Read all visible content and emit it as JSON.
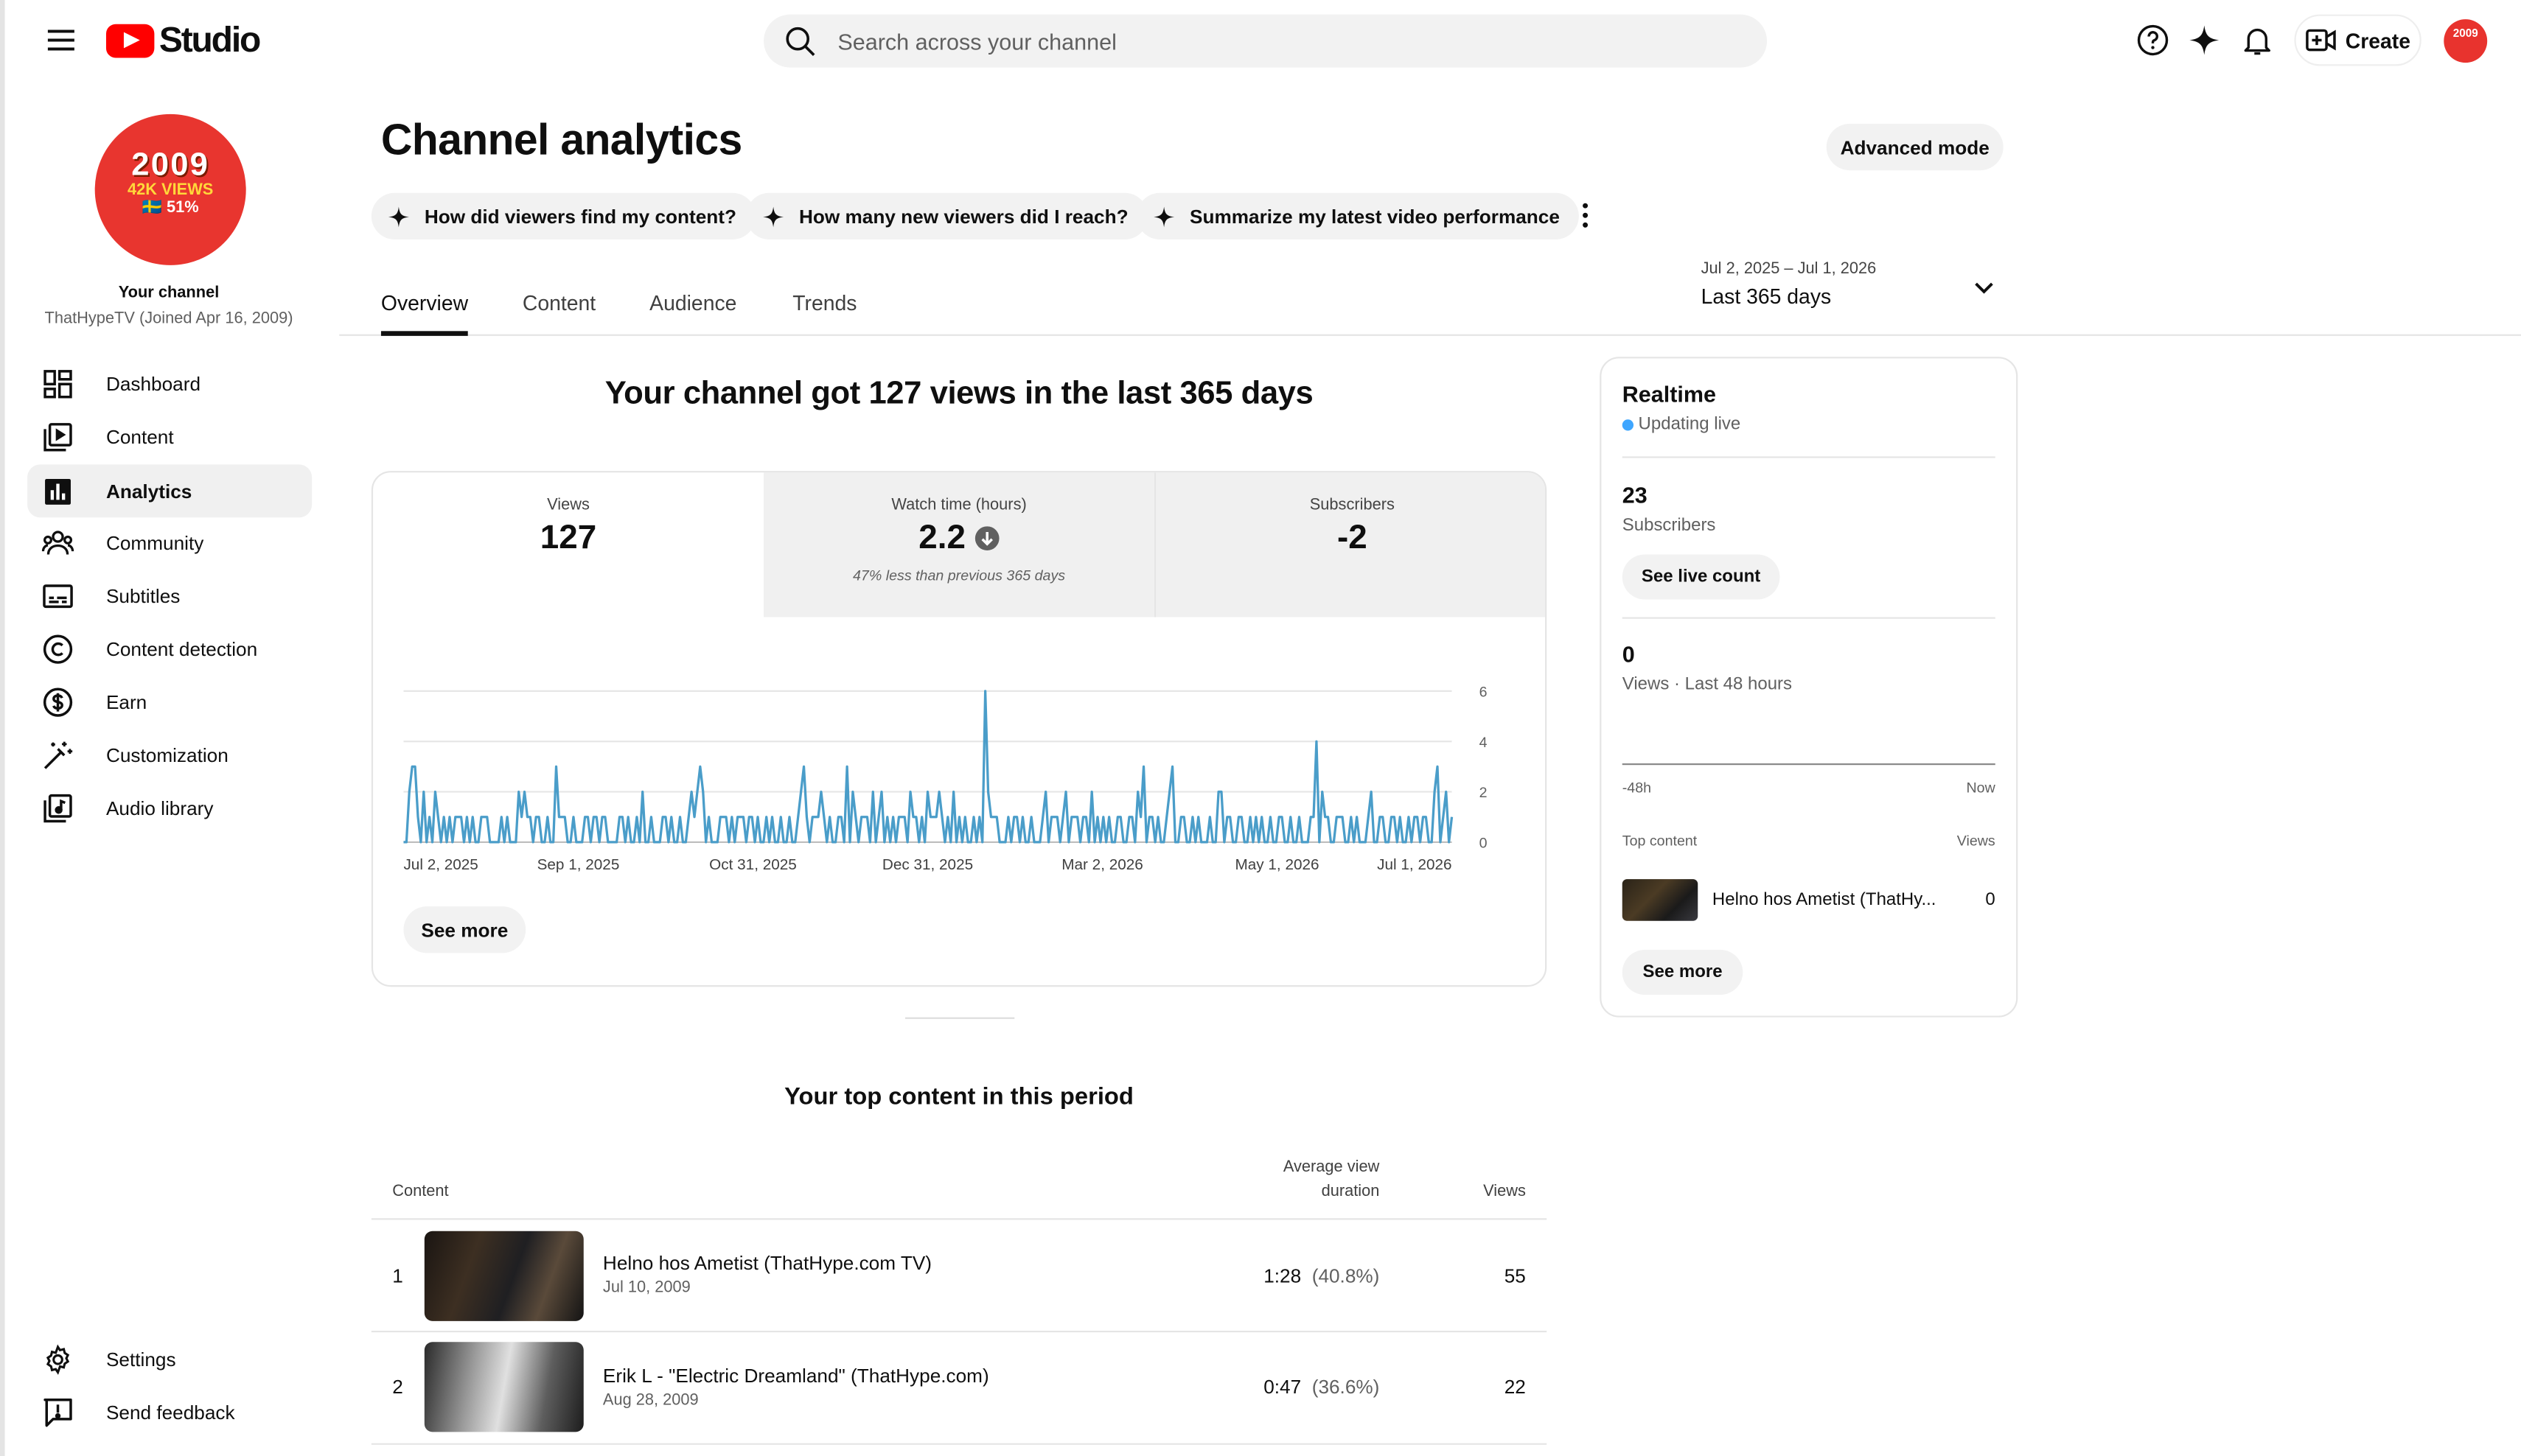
{
  "header": {
    "logo_text": "Studio",
    "search_placeholder": "Search across your channel",
    "create_label": "Create"
  },
  "channel": {
    "avatar_lines": [
      "2009",
      "42K VIEWS",
      "🇸🇪 51%"
    ],
    "your_channel_label": "Your channel",
    "subtitle": "ThatHypeTV (Joined Apr 16, 2009)"
  },
  "sidebar": {
    "items": [
      {
        "label": "Dashboard",
        "icon": "dashboard-icon"
      },
      {
        "label": "Content",
        "icon": "content-icon"
      },
      {
        "label": "Analytics",
        "icon": "analytics-icon",
        "active": true
      },
      {
        "label": "Community",
        "icon": "community-icon"
      },
      {
        "label": "Subtitles",
        "icon": "subtitles-icon"
      },
      {
        "label": "Content detection",
        "icon": "copyright-icon"
      },
      {
        "label": "Earn",
        "icon": "dollar-icon"
      },
      {
        "label": "Customization",
        "icon": "magic-wand-icon"
      },
      {
        "label": "Audio library",
        "icon": "audio-library-icon"
      }
    ],
    "settings_label": "Settings",
    "feedback_label": "Send feedback"
  },
  "main": {
    "title": "Channel analytics",
    "advanced_mode_label": "Advanced mode",
    "chips": [
      "How did viewers find my content?",
      "How many new viewers did I reach?",
      "Summarize my latest video performance"
    ],
    "tabs": [
      "Overview",
      "Content",
      "Audience",
      "Trends"
    ],
    "active_tab": "Overview",
    "date_range": "Jul 2, 2025 – Jul 1, 2026",
    "date_label": "Last 365 days",
    "headline": "Your channel got 127 views in the last 365 days",
    "metrics": [
      {
        "label": "Views",
        "value": "127"
      },
      {
        "label": "Watch time (hours)",
        "value": "2.2",
        "note": "47% less than previous 365 days",
        "trend": "down"
      },
      {
        "label": "Subscribers",
        "value": "-2"
      }
    ],
    "see_more_label": "See more"
  },
  "chart_data": {
    "type": "line",
    "x_tick_labels": [
      "Jul 2, 2025",
      "Sep 1, 2025",
      "Oct 31, 2025",
      "Dec 31, 2025",
      "Mar 2, 2026",
      "May 1, 2026",
      "Jul 1, 2026"
    ],
    "y_ticks": [
      0,
      2,
      4,
      6
    ],
    "ylim": [
      0,
      6
    ],
    "days": 365,
    "color": "#4a9dc9",
    "grid": true,
    "spikes": [
      [
        2,
        2
      ],
      [
        4,
        3
      ],
      [
        5,
        1
      ],
      [
        7,
        2
      ],
      [
        9,
        1
      ],
      [
        11,
        2
      ],
      [
        12,
        1
      ],
      [
        18,
        1
      ],
      [
        20,
        1
      ],
      [
        22,
        1
      ],
      [
        24,
        1
      ],
      [
        27,
        1
      ],
      [
        29,
        1
      ],
      [
        34,
        1
      ],
      [
        36,
        1
      ],
      [
        40,
        2
      ],
      [
        42,
        2
      ],
      [
        43,
        1
      ],
      [
        46,
        1
      ],
      [
        50,
        1
      ],
      [
        54,
        1
      ],
      [
        55,
        1
      ],
      [
        59,
        1
      ],
      [
        64,
        1
      ],
      [
        66,
        1
      ],
      [
        70,
        1
      ],
      [
        75,
        1
      ],
      [
        76,
        1
      ],
      [
        81,
        1
      ],
      [
        83,
        2
      ],
      [
        86,
        1
      ],
      [
        90,
        1
      ],
      [
        93,
        1
      ],
      [
        99,
        1
      ],
      [
        101,
        1
      ],
      [
        104,
        2
      ],
      [
        106,
        1
      ],
      [
        110,
        1
      ],
      [
        114,
        1
      ],
      [
        118,
        1
      ],
      [
        123,
        1
      ],
      [
        131,
        1
      ],
      [
        134,
        1
      ],
      [
        142,
        1
      ],
      [
        148,
        1
      ],
      [
        151,
        1
      ],
      [
        157,
        1
      ],
      [
        161,
        1
      ],
      [
        165,
        1
      ],
      [
        168,
        1
      ],
      [
        172,
        1
      ],
      [
        177,
        1
      ],
      [
        184,
        1
      ],
      [
        187,
        1
      ],
      [
        191,
        1
      ],
      [
        198,
        1
      ],
      [
        200,
        1
      ],
      [
        204,
        1
      ],
      [
        210,
        1
      ],
      [
        212,
        1
      ],
      [
        218,
        1
      ],
      [
        222,
        1
      ],
      [
        227,
        1
      ],
      [
        233,
        1
      ],
      [
        237,
        1
      ],
      [
        241,
        1
      ],
      [
        245,
        1
      ],
      [
        249,
        1
      ],
      [
        252,
        1
      ],
      [
        256,
        1
      ],
      [
        262,
        1
      ],
      [
        265,
        1
      ],
      [
        271,
        1
      ],
      [
        274,
        1
      ],
      [
        280,
        1
      ],
      [
        286,
        1
      ],
      [
        290,
        1
      ],
      [
        294,
        1
      ],
      [
        301,
        1
      ],
      [
        304,
        1
      ],
      [
        308,
        1
      ],
      [
        315,
        1
      ],
      [
        319,
        1
      ],
      [
        324,
        1
      ],
      [
        329,
        1
      ],
      [
        335,
        1
      ],
      [
        339,
        1
      ],
      [
        343,
        1
      ],
      [
        349,
        1
      ],
      [
        352,
        1
      ],
      [
        358,
        1
      ],
      [
        361,
        1
      ],
      [
        364,
        1
      ],
      [
        47,
        1
      ],
      [
        78,
        1
      ],
      [
        146,
        1
      ],
      [
        183,
        1
      ],
      [
        226,
        1
      ],
      [
        232,
        1
      ],
      [
        253,
        1
      ],
      [
        291,
        1
      ],
      [
        321,
        1
      ],
      [
        344,
        1
      ],
      [
        14,
        1
      ],
      [
        16,
        1
      ],
      [
        44,
        1
      ],
      [
        56,
        1
      ],
      [
        67,
        1
      ],
      [
        96,
        1
      ],
      [
        120,
        1
      ],
      [
        137,
        1
      ],
      [
        152,
        1
      ],
      [
        170,
        1
      ],
      [
        195,
        1
      ],
      [
        215,
        1
      ],
      [
        243,
        1
      ],
      [
        259,
        1
      ],
      [
        276,
        1
      ],
      [
        296,
        1
      ],
      [
        311,
        1
      ],
      [
        331,
        1
      ],
      [
        355,
        1
      ],
      [
        3,
        3
      ],
      [
        19,
        1
      ],
      [
        28,
        1
      ],
      [
        41,
        1
      ],
      [
        53,
        3
      ],
      [
        63,
        1
      ],
      [
        69,
        1
      ],
      [
        91,
        1
      ],
      [
        100,
        2
      ],
      [
        112,
        1
      ],
      [
        126,
        1
      ],
      [
        128,
        1
      ],
      [
        138,
        2
      ],
      [
        139,
        3
      ],
      [
        140,
        1
      ],
      [
        156,
        2
      ],
      [
        166,
        2
      ],
      [
        176,
        2
      ],
      [
        178,
        1
      ],
      [
        182,
        2
      ],
      [
        193,
        1
      ],
      [
        213,
        1
      ],
      [
        223,
        2
      ],
      [
        236,
        1
      ],
      [
        260,
        1
      ],
      [
        270,
        1
      ],
      [
        287,
        1
      ],
      [
        298,
        1
      ],
      [
        325,
        1
      ],
      [
        340,
        1
      ],
      [
        351,
        1
      ],
      [
        359,
        1
      ],
      [
        110,
        1
      ],
      [
        111,
        1
      ],
      [
        116,
        1
      ],
      [
        117,
        1
      ],
      [
        121,
        1
      ],
      [
        143,
        1
      ],
      [
        144,
        1
      ],
      [
        145,
        2
      ],
      [
        159,
        1
      ],
      [
        160,
        1
      ],
      [
        163,
        1
      ],
      [
        173,
        1
      ],
      [
        174,
        1
      ],
      [
        180,
        1
      ],
      [
        185,
        1
      ],
      [
        186,
        2
      ],
      [
        189,
        1
      ],
      [
        205,
        1
      ],
      [
        206,
        1
      ],
      [
        225,
        1
      ],
      [
        229,
        1
      ],
      [
        230,
        2
      ],
      [
        234,
        1
      ],
      [
        239,
        2
      ],
      [
        248,
        1
      ],
      [
        255,
        2
      ],
      [
        266,
        2
      ],
      [
        283,
        1
      ],
      [
        284,
        2
      ],
      [
        305,
        1
      ],
      [
        316,
        1
      ],
      [
        317,
        1
      ],
      [
        326,
        1
      ],
      [
        336,
        2
      ],
      [
        346,
        1
      ],
      [
        354,
        1
      ],
      [
        362,
        2
      ],
      [
        102,
        2
      ],
      [
        103,
        3
      ],
      [
        154,
        3
      ],
      [
        163,
        2
      ],
      [
        191,
        2
      ],
      [
        202,
        6
      ],
      [
        203,
        2
      ],
      [
        257,
        3
      ],
      [
        283,
        2
      ],
      [
        267,
        3
      ],
      [
        317,
        4
      ],
      [
        319,
        2
      ],
      [
        320,
        1
      ],
      [
        358,
        2
      ],
      [
        359,
        3
      ]
    ]
  },
  "realtime": {
    "title": "Realtime",
    "status": "Updating live",
    "subscribers_value": "23",
    "subscribers_label": "Subscribers",
    "live_count_label": "See live count",
    "views_value": "0",
    "views_label": "Views · Last 48 hours",
    "axis_left": "-48h",
    "axis_right": "Now",
    "top_content_label": "Top content",
    "views_col_label": "Views",
    "top_item_title": "Helno hos Ametist (ThatHy...",
    "top_item_views": "0",
    "see_more_label": "See more"
  },
  "top_content": {
    "title": "Your top content in this period",
    "col_content": "Content",
    "col_avd_1": "Average view",
    "col_avd_2": "duration",
    "col_views": "Views",
    "rows": [
      {
        "rank": "1",
        "title": "Helno hos Ametist (ThatHype.com TV)",
        "date": "Jul 10, 2009",
        "avd": "1:28",
        "avd_pct": "(40.8%)",
        "views": "55"
      },
      {
        "rank": "2",
        "title": "Erik L - \"Electric Dreamland\" (ThatHype.com)",
        "date": "Aug 28, 2009",
        "avd": "0:47",
        "avd_pct": "(36.6%)",
        "views": "22"
      }
    ]
  }
}
